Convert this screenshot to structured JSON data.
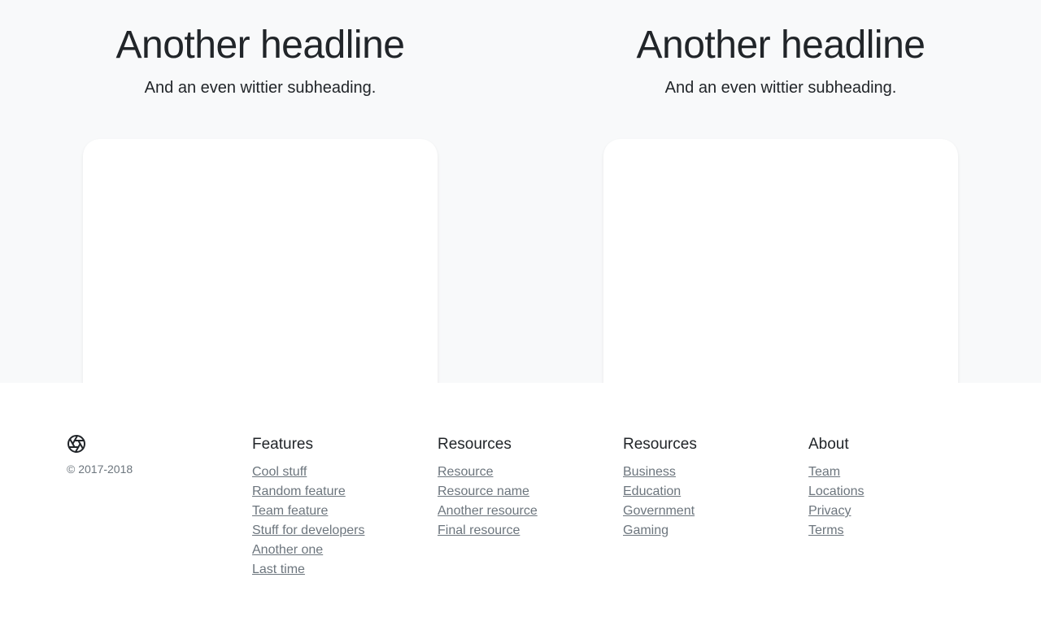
{
  "hero": [
    {
      "headline": "Another headline",
      "subheading": "And an even wittier subheading."
    },
    {
      "headline": "Another headline",
      "subheading": "And an even wittier subheading."
    }
  ],
  "footer": {
    "logo_icon": "aperture-icon",
    "copyright": "© 2017-2018",
    "columns": [
      {
        "title": "Features",
        "links": [
          "Cool stuff",
          "Random feature",
          "Team feature",
          "Stuff for developers",
          "Another one",
          "Last time"
        ]
      },
      {
        "title": "Resources",
        "links": [
          "Resource",
          "Resource name",
          "Another resource",
          "Final resource"
        ]
      },
      {
        "title": "Resources",
        "links": [
          "Business",
          "Education",
          "Government",
          "Gaming"
        ]
      },
      {
        "title": "About",
        "links": [
          "Team",
          "Locations",
          "Privacy",
          "Terms"
        ]
      }
    ]
  },
  "colors": {
    "band_bg": "#f8f9fa",
    "text": "#212529",
    "muted": "#6c757d"
  }
}
